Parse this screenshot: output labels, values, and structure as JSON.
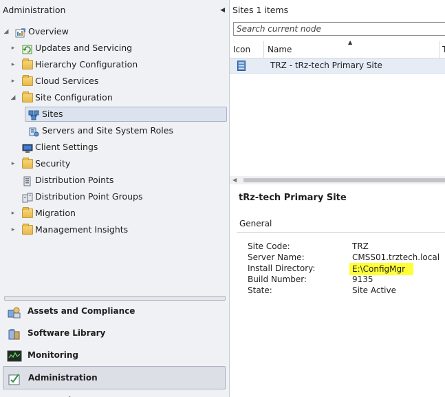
{
  "nav": {
    "title": "Administration",
    "tree": [
      {
        "label": "Overview",
        "icon": "overview-icon",
        "expanded": true
      },
      {
        "label": "Updates and Servicing",
        "icon": "updates-icon"
      },
      {
        "label": "Hierarchy Configuration",
        "icon": "folder-icon"
      },
      {
        "label": "Cloud Services",
        "icon": "folder-icon"
      },
      {
        "label": "Site Configuration",
        "icon": "folder-icon",
        "expanded": true
      },
      {
        "label": "Sites",
        "icon": "sites-icon",
        "selected": true
      },
      {
        "label": "Servers and Site System Roles",
        "icon": "servers-roles-icon"
      },
      {
        "label": "Client Settings",
        "icon": "client-settings-icon"
      },
      {
        "label": "Security",
        "icon": "folder-icon"
      },
      {
        "label": "Distribution Points",
        "icon": "distribution-point-icon"
      },
      {
        "label": "Distribution Point Groups",
        "icon": "distribution-group-icon"
      },
      {
        "label": "Migration",
        "icon": "folder-icon"
      },
      {
        "label": "Management Insights",
        "icon": "folder-icon"
      }
    ],
    "workspaces": [
      {
        "label": "Assets and Compliance",
        "icon": "assets-icon"
      },
      {
        "label": "Software Library",
        "icon": "software-library-icon"
      },
      {
        "label": "Monitoring",
        "icon": "monitoring-icon"
      },
      {
        "label": "Administration",
        "icon": "administration-icon",
        "selected": true
      },
      {
        "label": "Community",
        "icon": "community-icon"
      }
    ]
  },
  "list": {
    "title_bold": "Sites",
    "title_count": "1 items",
    "search_placeholder": "Search current node",
    "columns": [
      "Icon",
      "Name",
      "T"
    ],
    "rows": [
      {
        "name": "TRZ - tRz-tech Primary Site",
        "icon": "site-icon"
      }
    ]
  },
  "details": {
    "title": "tRz-tech Primary Site",
    "section": "General",
    "properties": [
      {
        "key": "Site Code:",
        "value": "TRZ"
      },
      {
        "key": "Server Name:",
        "value": "CMSS01.trztech.local"
      },
      {
        "key": "Install Directory:",
        "value": "E:\\ConfigMgr",
        "highlighted": true
      },
      {
        "key": "Build Number:",
        "value": "9135"
      },
      {
        "key": "State:",
        "value": "Site Active"
      }
    ]
  },
  "colors": {
    "selection": "#dce3ef",
    "highlight": "#ffff38",
    "folder": "#e8b94b"
  }
}
